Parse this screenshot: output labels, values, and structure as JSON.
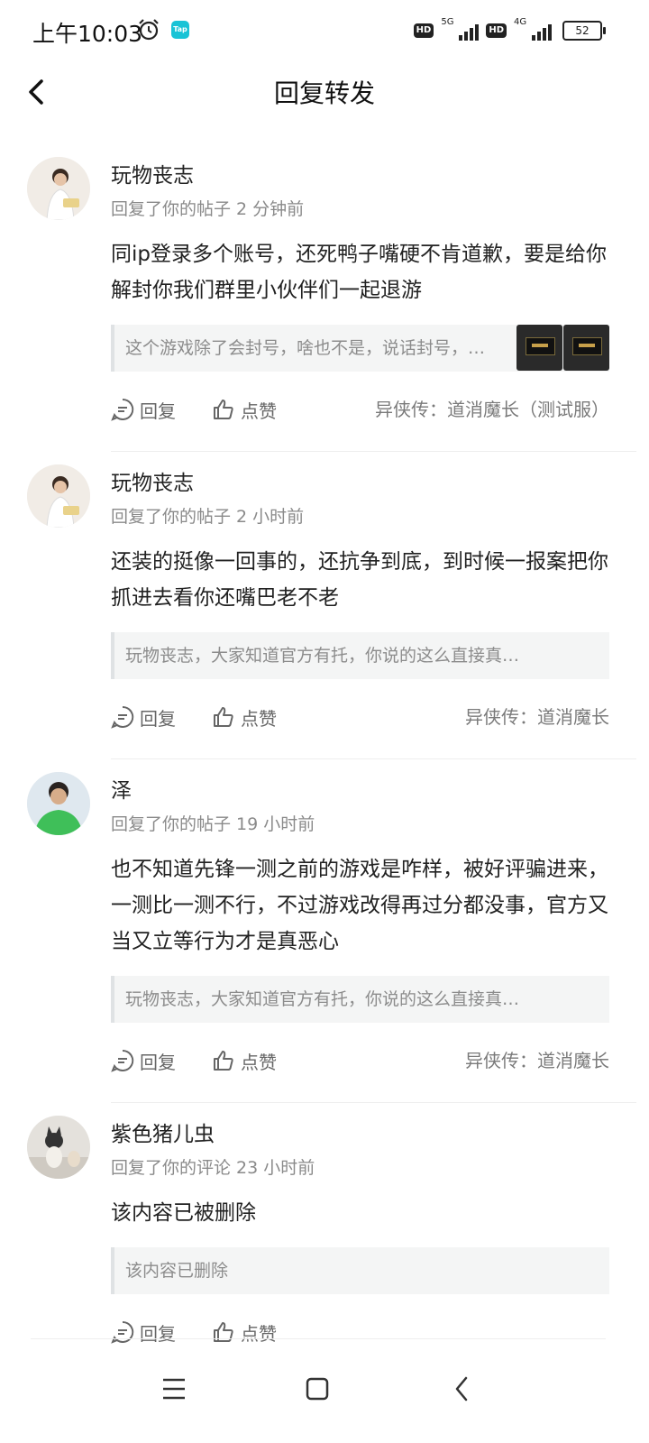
{
  "status_bar": {
    "time": "上午10:03",
    "tap_badge": "Tap",
    "hd_label": "HD",
    "net1": "5G",
    "net2": "4G",
    "battery": "52"
  },
  "header": {
    "title": "回复转发"
  },
  "actions": {
    "reply": "回复",
    "like": "点赞"
  },
  "comments": [
    {
      "user": "玩物丧志",
      "meta": "回复了你的帖子 2 分钟前",
      "text": "同ip登录多个账号，还死鸭子嘴硬不肯道歉，要是给你解封你我们群里小伙伴们一起退游",
      "quote": "这个游戏除了会封号，啥也不是，说话封号，…",
      "game": "异侠传：道消魔长（测试服）",
      "thumbs": 2,
      "avatar": "person-avatar"
    },
    {
      "user": "玩物丧志",
      "meta": "回复了你的帖子 2 小时前",
      "text": "还装的挺像一回事的，还抗争到底，到时候一报案把你抓进去看你还嘴巴老不老",
      "quote": "玩物丧志，大家知道官方有托，你说的这么直接真…",
      "game": "异侠传：道消魔长",
      "thumbs": 0,
      "avatar": "person-avatar"
    },
    {
      "user": "泽",
      "meta": "回复了你的帖子 19 小时前",
      "text": "也不知道先锋一测之前的游戏是咋样，被好评骗进来，一测比一测不行，不过游戏改得再过分都没事，官方又当又立等行为才是真恶心",
      "quote": "玩物丧志，大家知道官方有托，你说的这么直接真…",
      "game": "异侠传：道消魔长",
      "thumbs": 0,
      "avatar": "green-shirt-avatar"
    },
    {
      "user": "紫色猪儿虫",
      "meta": "回复了你的评论 23 小时前",
      "text": "该内容已被删除",
      "quote": "该内容已删除",
      "game": "",
      "thumbs": 0,
      "avatar": "cat-avatar"
    }
  ]
}
